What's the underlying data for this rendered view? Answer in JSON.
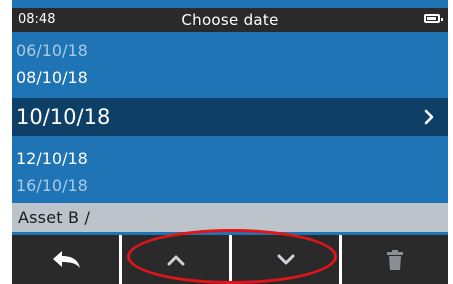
{
  "status": {
    "time": "08:48",
    "title": "Choose date",
    "battery_icon": "battery-icon"
  },
  "dates": {
    "items": [
      "06/10/18",
      "08/10/18",
      "10/10/18",
      "12/10/18",
      "16/10/18"
    ],
    "selected": "10/10/18"
  },
  "asset": {
    "label": "Asset B /"
  },
  "toolbar": {
    "buttons": [
      {
        "icon": "back-arrow-icon"
      },
      {
        "icon": "chevron-up-icon"
      },
      {
        "icon": "chevron-down-icon"
      },
      {
        "icon": "trash-icon"
      }
    ]
  },
  "colors": {
    "list_bg": "#1e74b4",
    "selected_bg": "#0e3f66",
    "bar_bg": "#2a2a2a",
    "asset_bg": "#bcc3cb",
    "highlight": "#e2141a"
  }
}
